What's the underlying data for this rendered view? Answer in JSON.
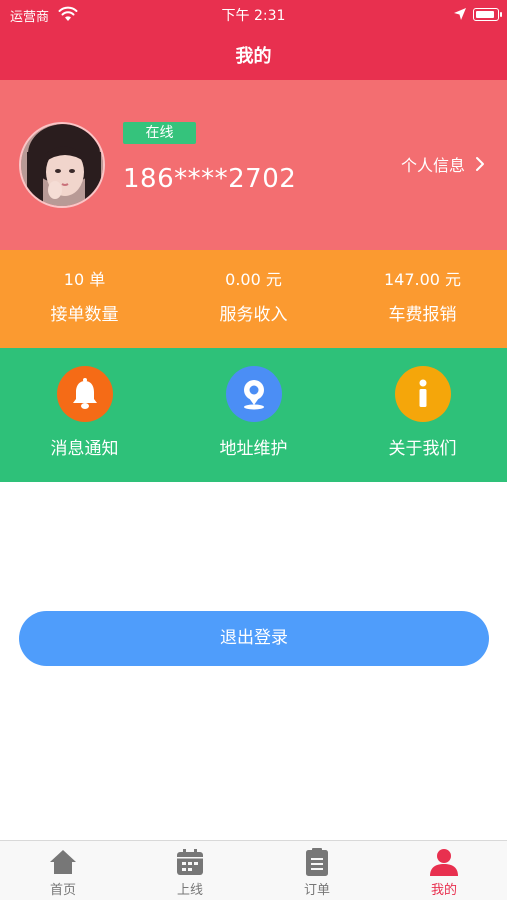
{
  "status_bar": {
    "carrier": "运营商",
    "time": "下午 2:31"
  },
  "nav": {
    "title": "我的"
  },
  "profile": {
    "status": "在线",
    "phone": "186****2702",
    "info_link": "个人信息"
  },
  "stats": [
    {
      "value": "10 单",
      "label": "接单数量"
    },
    {
      "value": "0.00 元",
      "label": "服务收入"
    },
    {
      "value": "147.00 元",
      "label": "车费报销"
    }
  ],
  "features": [
    {
      "label": "消息通知",
      "icon": "bell-icon",
      "color": "#f56b16"
    },
    {
      "label": "地址维护",
      "icon": "location-icon",
      "color": "#4b8ef5"
    },
    {
      "label": "关于我们",
      "icon": "info-icon",
      "color": "#f5a60a"
    }
  ],
  "logout": {
    "label": "退出登录"
  },
  "tabbar": {
    "active_color": "#e8304f",
    "items": [
      {
        "label": "首页",
        "icon": "home-icon"
      },
      {
        "label": "上线",
        "icon": "calendar-icon"
      },
      {
        "label": "订单",
        "icon": "clipboard-icon"
      },
      {
        "label": "我的",
        "icon": "user-icon"
      }
    ]
  },
  "colors": {
    "header": "#e8304f",
    "profile_bg": "#f36e71",
    "stats_bg": "#fb9a30",
    "features_bg": "#2ec179",
    "badge": "#35c37c",
    "logout": "#4f9dfb"
  }
}
